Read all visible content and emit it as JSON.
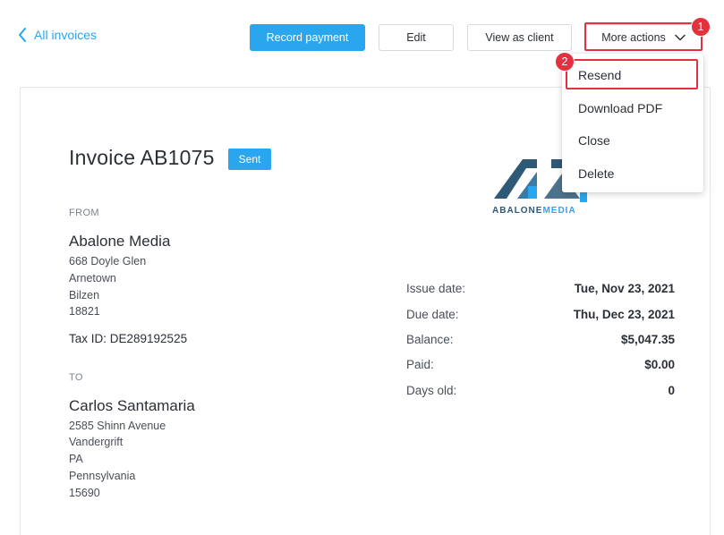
{
  "nav": {
    "back_label": "All invoices"
  },
  "toolbar": {
    "record_payment": "Record payment",
    "edit": "Edit",
    "view_as_client": "View as client",
    "more_actions": "More actions"
  },
  "steps": {
    "one": "1",
    "two": "2"
  },
  "dropdown": {
    "items": [
      "Resend",
      "Download PDF",
      "Close",
      "Delete"
    ]
  },
  "invoice": {
    "title": "Invoice AB1075",
    "status": "Sent",
    "from_label": "FROM",
    "to_label": "TO",
    "from": {
      "name": "Abalone Media",
      "address": [
        "668 Doyle Glen",
        "Arnetown",
        "Bilzen",
        "18821"
      ],
      "tax_id": "Tax ID: DE289192525"
    },
    "to": {
      "name": "Carlos Santamaria",
      "address": [
        "2585 Shinn Avenue",
        "Vandergrift",
        "PA",
        "Pennsylvania",
        "15690"
      ]
    },
    "logo_text": {
      "main": "ABALONE",
      "accent": "MEDIA"
    },
    "details": [
      {
        "label": "Issue date:",
        "value": "Tue, Nov 23, 2021"
      },
      {
        "label": "Due date:",
        "value": "Thu, Dec 23, 2021"
      },
      {
        "label": "Balance:",
        "value": "$5,047.35"
      },
      {
        "label": "Paid:",
        "value": "$0.00"
      },
      {
        "label": "Days old:",
        "value": "0"
      }
    ]
  },
  "colors": {
    "accent": "#2aa6ee",
    "highlight": "#e2323f",
    "logo_dark": "#2e5a78"
  }
}
